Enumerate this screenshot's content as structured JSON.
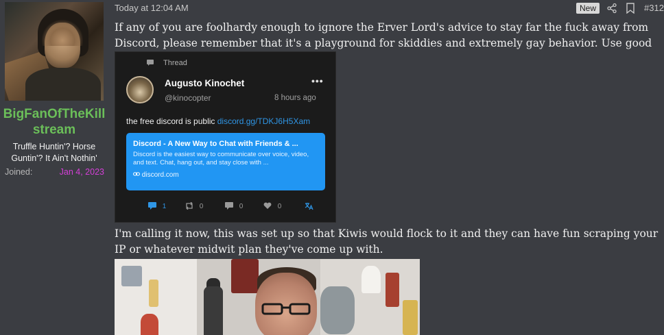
{
  "user": {
    "username_line1": "BigFanOfTheKill",
    "username_line2": "stream",
    "title_line1": "Truffle Huntin'? Horse",
    "title_line2": "Guntin'? It Ain't Nothin'",
    "joined_label": "Joined:",
    "joined_value": "Jan 4, 2023"
  },
  "header": {
    "timestamp": "Today at 12:04 AM",
    "new_badge": "New",
    "post_number": "#312"
  },
  "post": {
    "paragraph1": "If any of you are foolhardy enough to ignore the Erver Lord's advice to stay far the fuck away from Discord, please remember that it's a playground for skiddies and extremely gay behavior. Use good op-sec.",
    "paragraph2": "I'm calling it now, this was set up so that Kiwis would flock to it and they can have fun scraping your IP or whatever midwit plan they've come up with."
  },
  "embed": {
    "thread_label": "Thread",
    "name": "Augusto Kinochet",
    "handle": "@kinocopter",
    "more": "•••",
    "time": "8 hours ago",
    "text": "the free discord is public ",
    "link": "discord.gg/TDKJ6H5Xam",
    "card": {
      "title": "Discord - A New Way to Chat with Friends & ...",
      "description": "Discord is the easiest way to communicate over voice, video, and text. Chat, hang out, and stay close with ...",
      "domain": "discord.com"
    },
    "actions": {
      "replies": "1",
      "reposts": "0",
      "quotes": "0",
      "likes": "0"
    }
  },
  "colors": {
    "username": "#6bbf59",
    "joined_value": "#d43fd8",
    "card": "#2196f3",
    "link": "#2f96e6"
  }
}
